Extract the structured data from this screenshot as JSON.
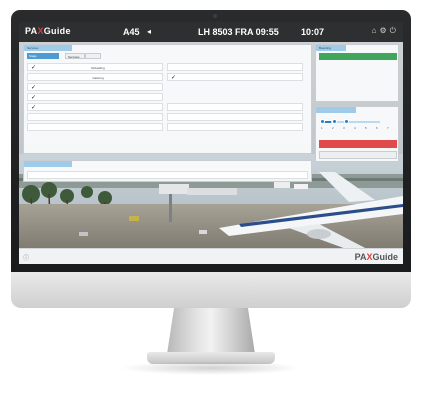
{
  "app": {
    "logo_prefix": "PA",
    "logo_mark": "X",
    "logo_suffix": "Guide",
    "gate": "A45",
    "flight_info": "LH 8503 FRA 09:55",
    "clock": "10:07",
    "top_icons": [
      "home-icon",
      "gear-icon",
      "power-icon"
    ]
  },
  "services": {
    "title": "Services",
    "tabs": [
      "Stage",
      "",
      "Services",
      ""
    ],
    "rows": [
      {
        "left": {
          "checked": true,
          "label": "Refuelling",
          "value": ""
        },
        "right": {
          "checked": false,
          "label": "",
          "value": ""
        }
      },
      {
        "left": {
          "checked": false,
          "label": "Catering",
          "value": ""
        },
        "right": {
          "checked": true,
          "label": "",
          "value": ""
        }
      },
      {
        "left": {
          "checked": true,
          "label": "",
          "value": ""
        },
        "right": {
          "checked": false,
          "label": "",
          "value": ""
        }
      },
      {
        "left": {
          "checked": true,
          "label": "",
          "value": ""
        },
        "right": {
          "checked": false,
          "label": "",
          "value": ""
        }
      },
      {
        "left": {
          "checked": true,
          "label": "",
          "value": ""
        },
        "right": {
          "checked": false,
          "label": "",
          "value": ""
        }
      },
      {
        "left": {
          "checked": false,
          "label": "",
          "value": ""
        },
        "right": {
          "checked": false,
          "label": "",
          "value": ""
        }
      },
      {
        "left": {
          "checked": false,
          "label": "",
          "value": ""
        },
        "right": {
          "checked": false,
          "label": "",
          "value": ""
        }
      }
    ]
  },
  "dispatch": {
    "title": "",
    "row_label": ""
  },
  "boarding": {
    "title": "Boarding",
    "button_label": "",
    "rows": [
      {
        "label": "",
        "value": ""
      },
      {
        "label": "",
        "value": ""
      },
      {
        "label": "",
        "value": ""
      },
      {
        "label": "",
        "value": ""
      }
    ]
  },
  "progress": {
    "title": "",
    "level": 0.15,
    "ticks": [
      "1",
      "2",
      "3",
      "4",
      "5",
      "6",
      "7"
    ],
    "red_button": "",
    "grey_button": ""
  },
  "footer": {
    "text": ""
  },
  "colors": {
    "accent_blue": "#4c9cd3",
    "green": "#3fa65b",
    "red": "#e04a4a",
    "brand_x": "#e23b3b"
  }
}
